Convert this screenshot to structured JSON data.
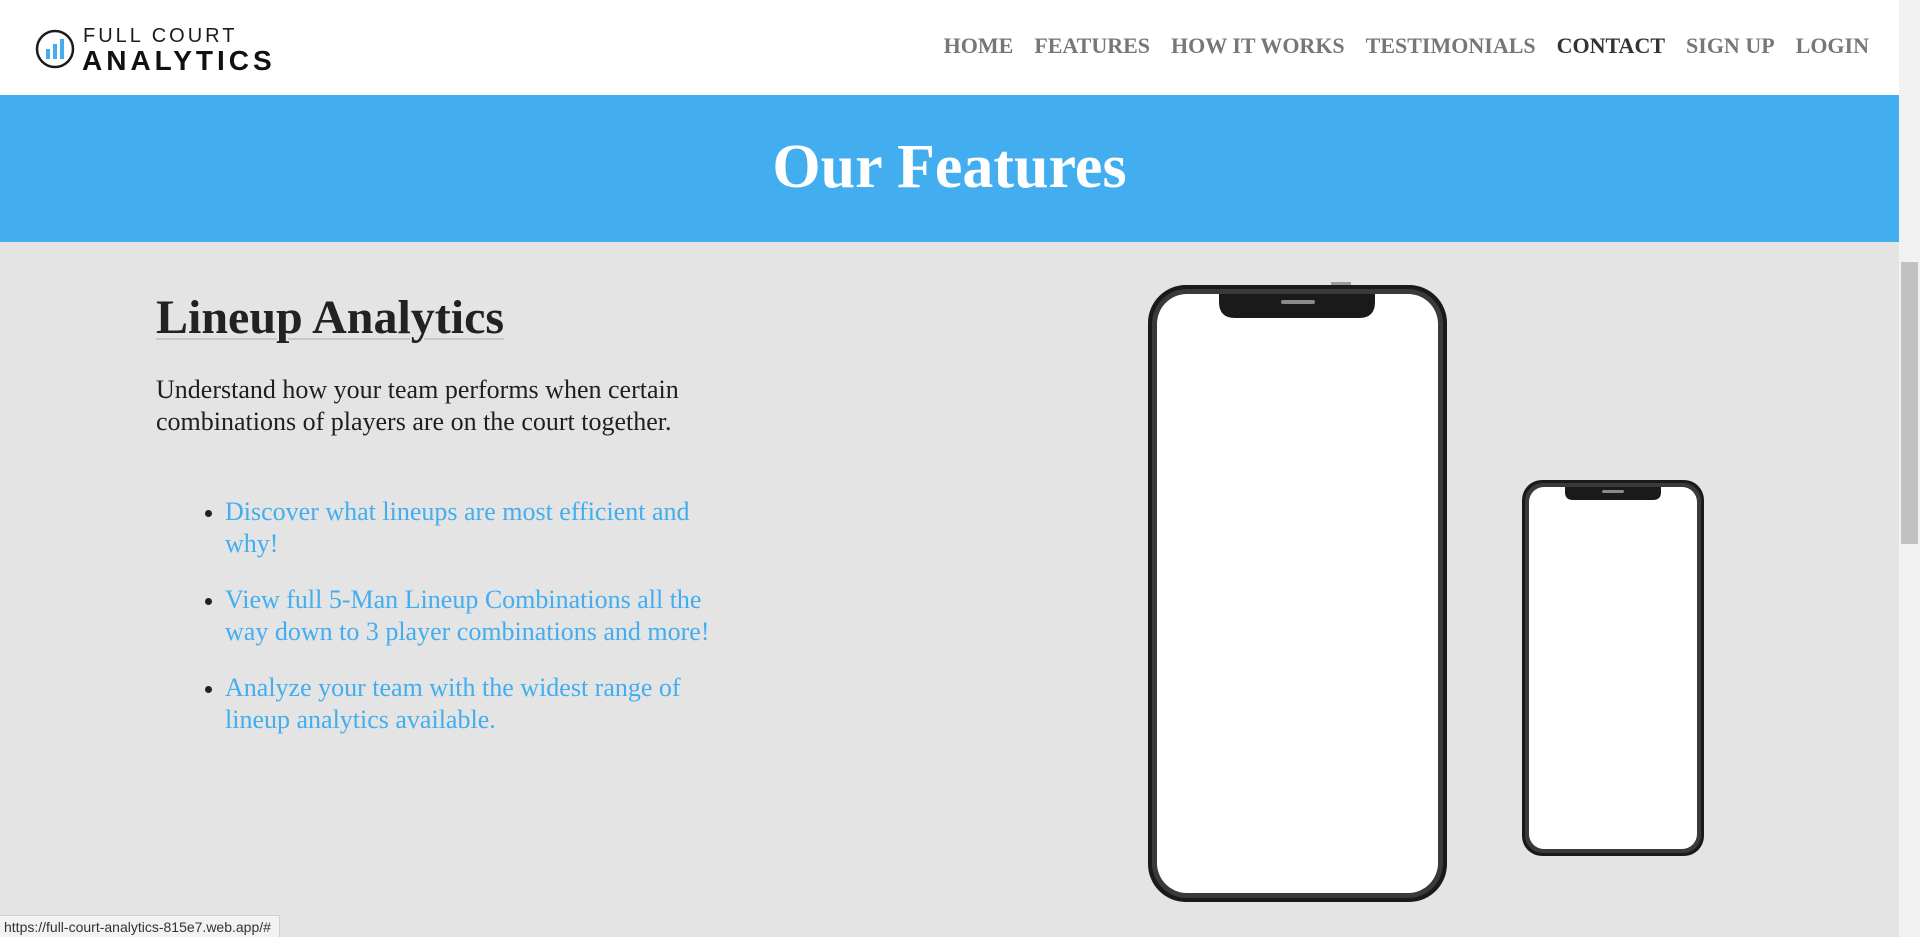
{
  "header": {
    "logo": {
      "line1": "FULL COURT",
      "line2": "ANALYTICS",
      "icon": "bar-chart-circle-icon"
    },
    "nav": [
      {
        "label": "HOME"
      },
      {
        "label": "FEATURES"
      },
      {
        "label": "HOW IT WORKS"
      },
      {
        "label": "TESTIMONIALS"
      },
      {
        "label": "CONTACT",
        "active": true
      },
      {
        "label": "SIGN UP"
      },
      {
        "label": "LOGIN"
      }
    ]
  },
  "banner": {
    "title": "Our Features"
  },
  "feature": {
    "title": "Lineup Analytics",
    "description": "Understand how your team performs when certain combinations of players are on the court together.",
    "bullets": [
      "Discover what lineups are most efficient and why!",
      "View full 5-Man Lineup Combinations all the way down to 3 player combinations and more!",
      "Analyze your team with the widest range of lineup analytics available."
    ]
  },
  "status_bar": {
    "url": "https://full-court-analytics-815e7.web.app/#"
  },
  "colors": {
    "accent": "#42aef0",
    "nav_text": "#777777",
    "nav_active": "#333333",
    "section_bg": "#e4e4e4"
  }
}
